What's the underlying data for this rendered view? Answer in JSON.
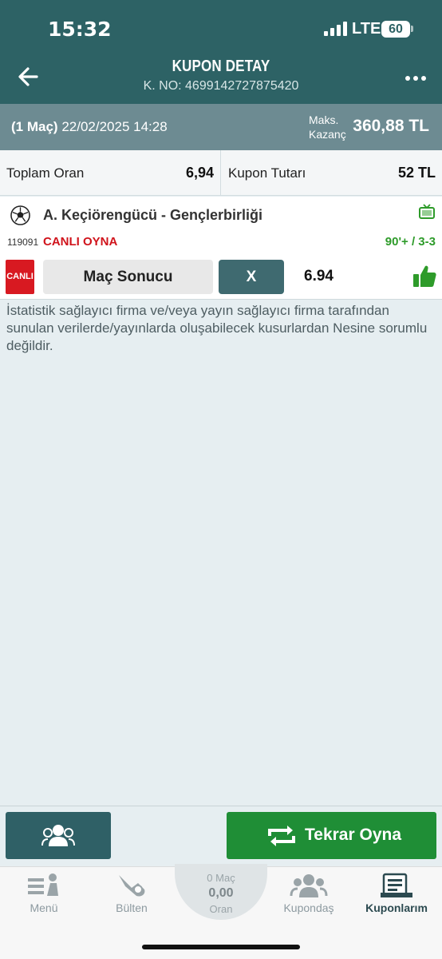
{
  "status_bar": {
    "time": "15:32",
    "network": "LTE",
    "battery": "60"
  },
  "header": {
    "title": "KUPON DETAY",
    "coupon_no": "K. NO: 4699142727875420"
  },
  "summary": {
    "match_count": "(1 Maç)",
    "datetime": "22/02/2025 14:28",
    "max_label_1": "Maks.",
    "max_label_2": "Kazanç",
    "max_value": "360,88 TL"
  },
  "totals": {
    "total_odds_label": "Toplam Oran",
    "total_odds_value": "6,94",
    "coupon_amount_label": "Kupon Tutarı",
    "coupon_amount_value": "52 TL"
  },
  "match": {
    "name": "A. Keçiörengücü - Gençlerbirliği",
    "code": "119091",
    "live_play": "CANLI OYNA",
    "score": "90'+ / 3-3",
    "live_badge": "CANLI",
    "market": "Maç Sonucu",
    "pick": "X",
    "odd": "6.94"
  },
  "disclaimer": "İstatistik sağlayıcı firma ve/veya yayın sağlayıcı firma tarafından sunulan verilerde/yayınlarda oluşabilecek kusurlardan Nesine sorumlu değildir.",
  "actions": {
    "replay_label": "Tekrar Oyna"
  },
  "tabbar": {
    "menu": "Menü",
    "bulletin": "Bülten",
    "slip_count": "0 Maç",
    "slip_odd": "0,00",
    "slip_label": "Oran",
    "kupondas": "Kupondaş",
    "my_coupons": "Kuponlarım"
  },
  "colors": {
    "header": "#2d6265",
    "summary": "#6d8b92",
    "live_red": "#d81921",
    "score_green": "#2e9b2a",
    "replay_green": "#1f8e36"
  }
}
